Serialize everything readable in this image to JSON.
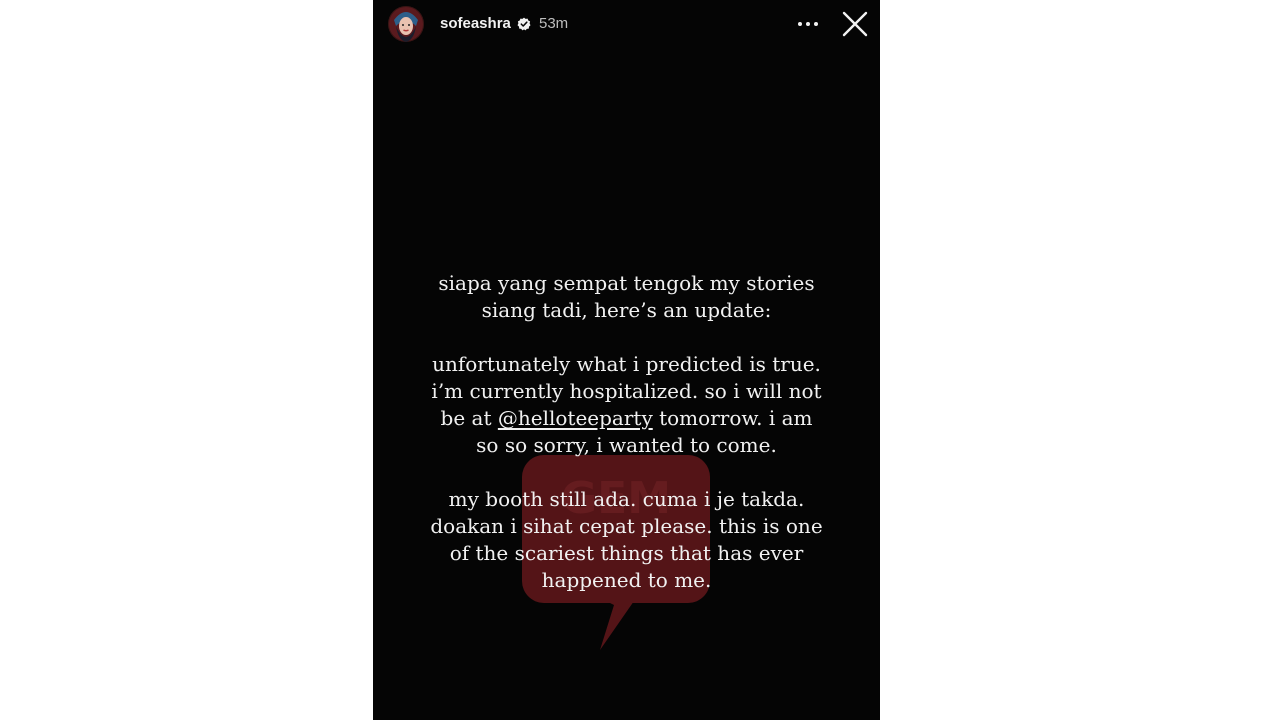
{
  "header": {
    "username": "sofeashra",
    "timestamp": "53m",
    "avatar_icon": "avatar",
    "verified_icon": "verified-badge-icon",
    "more_icon": "more-horizontal-icon",
    "close_icon": "close-icon"
  },
  "story": {
    "paragraph1": {
      "line1": "siapa yang sempat tengok my stories",
      "line2": "siang tadi, here’s an update:"
    },
    "paragraph2": {
      "line1": "unfortunately what i predicted is true.",
      "line2": "i’m currently hospitalized. so i will not",
      "line3_before": "be at ",
      "mention": "@helloteeparty",
      "line3_after": " tomorrow. i am",
      "line4": "so so sorry, i wanted to come."
    },
    "paragraph3": {
      "line1": "my booth still ada. cuma i je takda.",
      "line2": "doakan i sihat cepat please. this is one",
      "line3": "of the scariest things that has ever",
      "line4": "happened to me."
    }
  },
  "watermark": {
    "text": "GEM",
    "color": "#b3262b"
  },
  "colors": {
    "story_background": "#050505",
    "text": "#f1f1f1",
    "page_background": "#ffffff"
  }
}
